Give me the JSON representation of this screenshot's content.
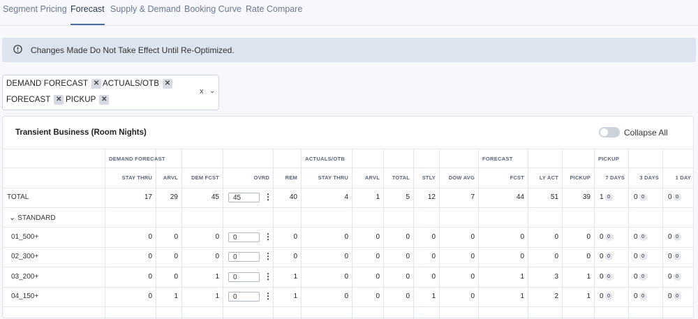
{
  "tabs": [
    "Segment Pricing",
    "Forecast",
    "Supply & Demand",
    "Booking Curve",
    "Rate Compare"
  ],
  "active_tab": "Forecast",
  "alert": {
    "text": "Changes Made Do Not Take Effect Until Re-Optimized.",
    "icon": "info-icon"
  },
  "filter": {
    "chips": [
      "DEMAND FORECAST",
      "ACTUALS/OTB",
      "FORECAST",
      "PICKUP"
    ],
    "clear": "x",
    "chevron": "⌄"
  },
  "panel": {
    "title": "Transient Business (Room Nights)",
    "toggle_label": "Collapse All",
    "toggle_on": false
  },
  "groups": [
    "DEMAND FORECAST",
    "ACTUALS/OTB",
    "FORECAST",
    "PICKUP"
  ],
  "columns": [
    "STAY THRU",
    "ARVL",
    "DEM FCST",
    "OVRD",
    "REM",
    "STAY THRU",
    "ARVL",
    "TOTAL",
    "STLY",
    "DOW AVG",
    "FCST",
    "LY ACT",
    "PICKUP",
    "7 DAYS",
    "3 DAYS",
    "1 DAY"
  ],
  "total_row": {
    "label": "TOTAL",
    "values": [
      "17",
      "29",
      "45",
      "40",
      "4",
      "1",
      "5",
      "12",
      "7",
      "44",
      "51",
      "39"
    ],
    "ovrd": "45",
    "pickup": [
      [
        "1",
        "0"
      ],
      [
        "0",
        "0"
      ],
      [
        "0",
        "0"
      ]
    ]
  },
  "section": {
    "label": "STANDARD",
    "chevron": "chevron-down-icon"
  },
  "rows": [
    {
      "label": "01_500+",
      "values": [
        "0",
        "0",
        "0",
        "0",
        "0",
        "0",
        "0",
        "0",
        "0",
        "0",
        "0",
        "0"
      ],
      "ovrd": "0",
      "pickup": [
        [
          "0",
          "0"
        ],
        [
          "0",
          "0"
        ],
        [
          "0",
          "0"
        ]
      ]
    },
    {
      "label": "02_300+",
      "values": [
        "0",
        "0",
        "0",
        "0",
        "0",
        "0",
        "0",
        "0",
        "0",
        "0",
        "0",
        "0"
      ],
      "ovrd": "0",
      "pickup": [
        [
          "0",
          "0"
        ],
        [
          "0",
          "0"
        ],
        [
          "0",
          "0"
        ]
      ]
    },
    {
      "label": "03_200+",
      "values": [
        "0",
        "0",
        "1",
        "1",
        "0",
        "0",
        "0",
        "0",
        "0",
        "1",
        "3",
        "1"
      ],
      "ovrd": "0",
      "pickup": [
        [
          "0",
          "0"
        ],
        [
          "0",
          "0"
        ],
        [
          "0",
          "0"
        ]
      ]
    },
    {
      "label": "04_150+",
      "values": [
        "0",
        "1",
        "1",
        "1",
        "0",
        "0",
        "0",
        "1",
        "0",
        "1",
        "2",
        "1"
      ],
      "ovrd": "0",
      "pickup": [
        [
          "0",
          "0"
        ],
        [
          "0",
          "0"
        ],
        [
          "0",
          "0"
        ]
      ]
    }
  ]
}
